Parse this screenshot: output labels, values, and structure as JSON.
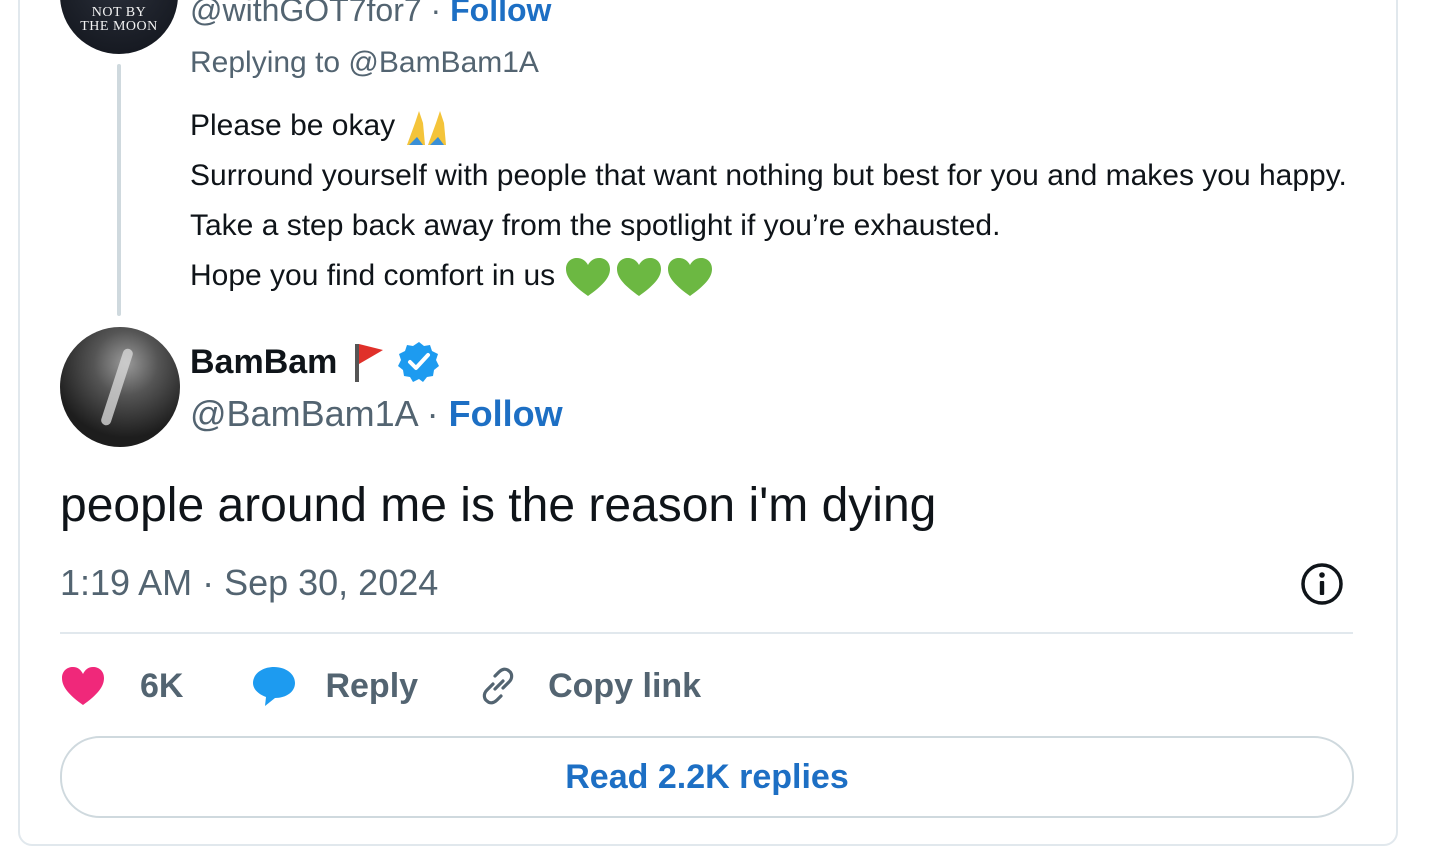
{
  "parent_tweet": {
    "avatar_text_1": "NOT BY",
    "avatar_text_2": "THE MOON",
    "handle": "@withGOT7for7",
    "separator": " · ",
    "follow_label": "Follow",
    "replying_to": "Replying to @BamBam1A",
    "lines": [
      "Please be okay",
      "Surround yourself with people that want nothing but best for you and makes you happy. Take a step back away from the spotlight if you’re exhausted.",
      "Hope you find comfort in us"
    ],
    "emoji_after_line_1": "praying-hands x2",
    "emoji_after_line_3": "green-heart x3"
  },
  "tweet": {
    "name": "BamBam",
    "badges": [
      "red-flag-icon",
      "verified-icon"
    ],
    "handle": "@BamBam1A",
    "separator": " · ",
    "follow_label": "Follow",
    "text": "people around me is the reason i'm dying",
    "timestamp": "1:19 AM · Sep 30, 2024"
  },
  "actions": {
    "like_count": "6K",
    "reply_label": "Reply",
    "copy_label": "Copy link"
  },
  "read_replies_label": "Read 2.2K replies",
  "colors": {
    "accent": "#1d6fc4",
    "like": "#f0287a",
    "reply_bubble": "#1d9bf0",
    "heart_green": "#6cb842",
    "muted": "#536471"
  }
}
